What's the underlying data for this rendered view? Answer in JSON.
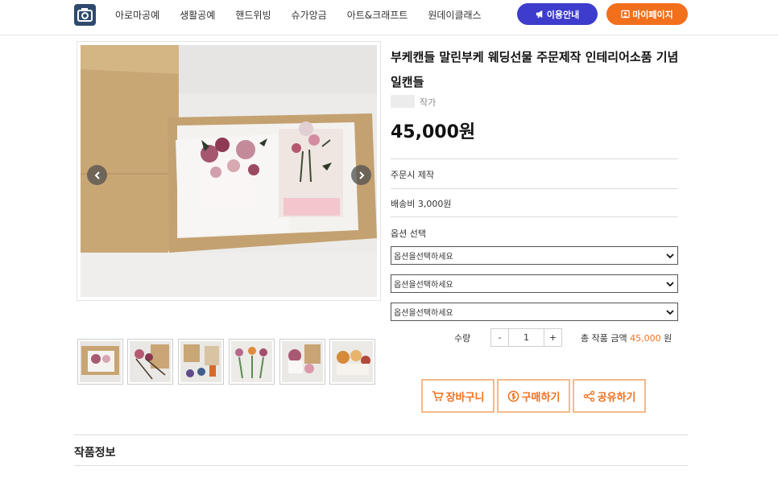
{
  "header": {
    "logo_icon": "camera-logo-icon",
    "nav": [
      "아로마공예",
      "생활공예",
      "핸드위빙",
      "슈가앙금",
      "아트&크래프트",
      "원데이클래스"
    ],
    "guide_label": "이용안내",
    "mypage_label": "마이페이지",
    "guide_color": "#3d3ccc",
    "mypage_color": "#f26f1c"
  },
  "product": {
    "title": "부케캔들 말린부케 웨딩선물 주문제작 인테리어소품 기념일캔들",
    "artist_suffix": "작가",
    "price": "45,000원",
    "order_type": "주문시 제작",
    "shipping": "배송비 3,000원",
    "options_label": "옵션 선택",
    "option_placeholders": [
      "옵션을선택하세요",
      "옵션을선택하세요",
      "옵션을선택하세요"
    ],
    "quantity_label": "수량",
    "quantity_value": "1",
    "minus": "-",
    "plus": "+",
    "total_label": "총 작품 금액",
    "total_amount": "45,000",
    "total_unit": "원"
  },
  "actions": {
    "cart": "장바구니",
    "buy": "구매하기",
    "share": "공유하기",
    "accent": "#f26f1c"
  },
  "section": {
    "title": "작품정보"
  }
}
